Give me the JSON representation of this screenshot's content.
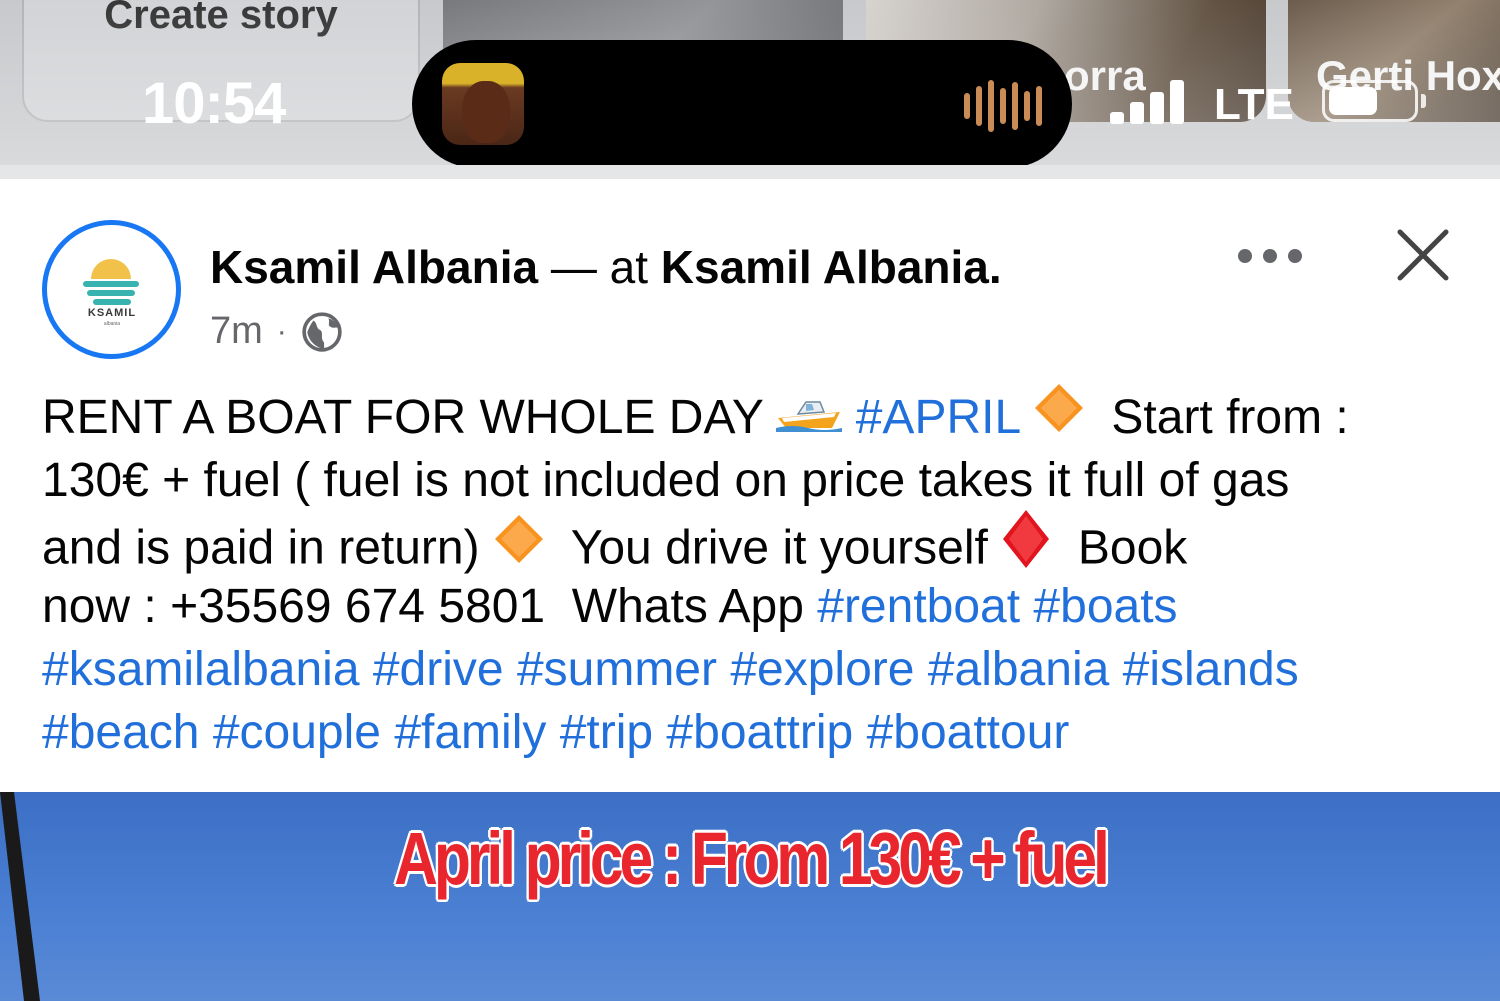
{
  "status_bar": {
    "time": "10:54",
    "network": "LTE",
    "signal_bars": 4
  },
  "stories": {
    "create_label": "Create story",
    "items": [
      {
        "name": ""
      },
      {
        "name": "orra"
      },
      {
        "name": "Gerti Hox"
      }
    ]
  },
  "post": {
    "author": "Ksamil Albania",
    "separator": "—",
    "at_text": "at",
    "location": "Ksamil Albania.",
    "time_ago": "7m",
    "audience": "Public",
    "avatar_logo_text": "KSAMIL",
    "avatar_logo_sub": "albania",
    "lines": [
      [
        {
          "t": "text",
          "v": "RENT A BOAT FOR WHOLE DAY "
        },
        {
          "t": "emoji",
          "v": "speedboat"
        },
        {
          "t": "text",
          "v": " "
        },
        {
          "t": "tag",
          "v": "#APRIL"
        },
        {
          "t": "text",
          "v": " "
        },
        {
          "t": "emoji",
          "v": "orange-diamond"
        },
        {
          "t": "text",
          "v": "  Start from :"
        }
      ],
      [
        {
          "t": "text",
          "v": "130€ + fuel ( fuel is not included on price takes it full of gas"
        }
      ],
      [
        {
          "t": "text",
          "v": "and is paid in return) "
        },
        {
          "t": "emoji",
          "v": "orange-diamond"
        },
        {
          "t": "text",
          "v": "  You drive it yourself "
        },
        {
          "t": "emoji",
          "v": "red-diamond"
        },
        {
          "t": "text",
          "v": "  Book"
        }
      ],
      [
        {
          "t": "text",
          "v": "now : +35569 674 5801  Whats App "
        },
        {
          "t": "tag",
          "v": "#rentboat"
        },
        {
          "t": "text",
          "v": " "
        },
        {
          "t": "tag",
          "v": "#boats"
        }
      ],
      [
        {
          "t": "tag",
          "v": "#ksamilalbania"
        },
        {
          "t": "text",
          "v": " "
        },
        {
          "t": "tag",
          "v": "#drive"
        },
        {
          "t": "text",
          "v": " "
        },
        {
          "t": "tag",
          "v": "#summer"
        },
        {
          "t": "text",
          "v": " "
        },
        {
          "t": "tag",
          "v": "#explore"
        },
        {
          "t": "text",
          "v": " "
        },
        {
          "t": "tag",
          "v": "#albania"
        },
        {
          "t": "text",
          "v": " "
        },
        {
          "t": "tag",
          "v": "#islands"
        }
      ],
      [
        {
          "t": "tag",
          "v": "#beach"
        },
        {
          "t": "text",
          "v": " "
        },
        {
          "t": "tag",
          "v": "#couple"
        },
        {
          "t": "text",
          "v": " "
        },
        {
          "t": "tag",
          "v": "#family"
        },
        {
          "t": "text",
          "v": " "
        },
        {
          "t": "tag",
          "v": "#trip"
        },
        {
          "t": "text",
          "v": " "
        },
        {
          "t": "tag",
          "v": "#boattrip"
        },
        {
          "t": "text",
          "v": " "
        },
        {
          "t": "tag",
          "v": "#boattour"
        }
      ]
    ],
    "image_caption": "April price : From 130€ + fuel"
  },
  "colors": {
    "accent": "#1877f2",
    "hashtag": "#216fdb",
    "text": "#050505",
    "meta": "#65676b",
    "banner_red": "#e9262e",
    "sky": "#4b80d3"
  },
  "icons": [
    "globe-icon",
    "more-icon",
    "close-icon",
    "audio-wave-icon",
    "signal-icon",
    "battery-icon",
    "speedboat-emoji",
    "orange-diamond-emoji",
    "red-diamond-emoji"
  ]
}
